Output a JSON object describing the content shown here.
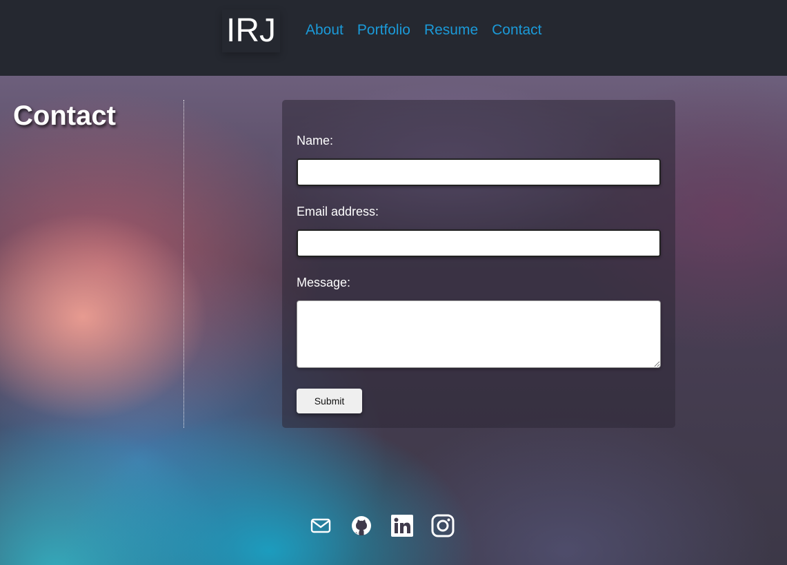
{
  "header": {
    "logo": "IRJ",
    "nav": [
      "About",
      "Portfolio",
      "Resume",
      "Contact"
    ]
  },
  "page": {
    "title": "Contact"
  },
  "form": {
    "name_label": "Name:",
    "email_label": "Email address:",
    "message_label": "Message:",
    "name_value": "",
    "email_value": "",
    "message_value": "",
    "submit_label": "Submit"
  },
  "socials": [
    {
      "icon": "mail-icon"
    },
    {
      "icon": "github-icon"
    },
    {
      "icon": "linkedin-icon"
    },
    {
      "icon": "instagram-icon"
    }
  ],
  "colors": {
    "header_bg": "#252830",
    "nav_link": "#1b9ad8",
    "text": "#ffffff"
  }
}
